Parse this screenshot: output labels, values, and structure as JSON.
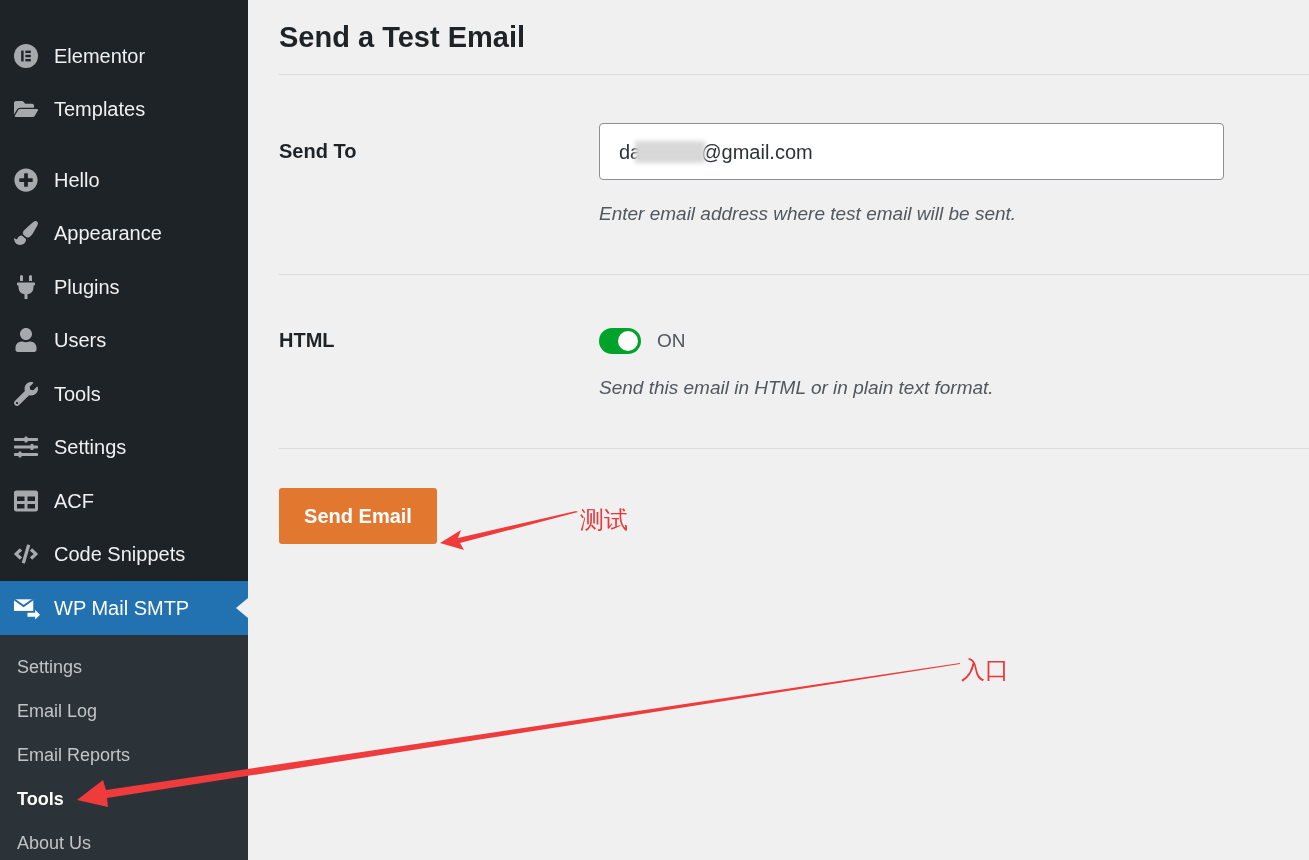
{
  "sidebar": {
    "groups": [
      [
        {
          "label": "Elementor",
          "selected": false
        },
        {
          "label": "Templates",
          "selected": false
        }
      ],
      [
        {
          "label": "Hello",
          "selected": false
        },
        {
          "label": "Appearance",
          "selected": false
        },
        {
          "label": "Plugins",
          "selected": false
        },
        {
          "label": "Users",
          "selected": false
        },
        {
          "label": "Tools",
          "selected": false
        },
        {
          "label": "Settings",
          "selected": false
        },
        {
          "label": "ACF",
          "selected": false
        },
        {
          "label": "Code Snippets",
          "selected": false
        },
        {
          "label": "WP Mail SMTP",
          "selected": true
        }
      ]
    ],
    "submenu": [
      {
        "label": "Settings",
        "selected": false
      },
      {
        "label": "Email Log",
        "selected": false
      },
      {
        "label": "Email Reports",
        "selected": false
      },
      {
        "label": "Tools",
        "selected": true
      },
      {
        "label": "About Us",
        "selected": false
      }
    ]
  },
  "main": {
    "title": "Send a Test Email",
    "send_to": {
      "label": "Send To",
      "value_start": "da",
      "redacted": true,
      "value_end": "@gmail.com",
      "hint": "Enter email address where test email will be sent."
    },
    "html": {
      "label": "HTML",
      "on": true,
      "state_text": "ON",
      "hint": "Send this email in HTML or in plain text format."
    },
    "button": "Send Email"
  },
  "annotations": [
    {
      "text": "测试"
    },
    {
      "text": "入口"
    }
  ]
}
